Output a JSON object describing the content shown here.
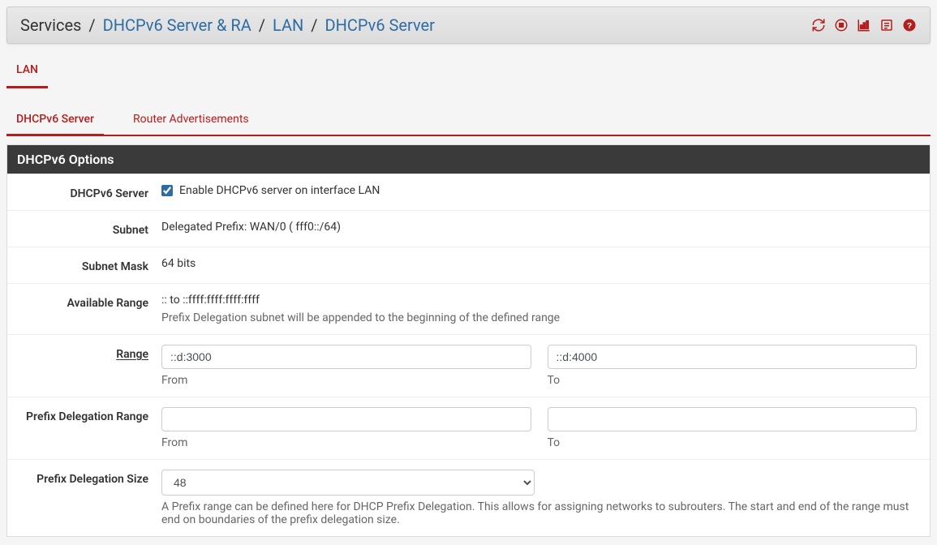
{
  "breadcrumb": {
    "root": "Services",
    "level1": "DHCPv6 Server & RA",
    "level2": "LAN",
    "level3": "DHCPv6 Server"
  },
  "header_icons": {
    "refresh": "refresh-icon",
    "stop": "stop-icon",
    "stats": "stats-icon",
    "log": "log-icon",
    "help": "help-icon"
  },
  "tabs_primary": [
    {
      "label": "LAN",
      "active": true
    }
  ],
  "tabs_secondary": [
    {
      "label": "DHCPv6 Server",
      "active": true
    },
    {
      "label": "Router Advertisements",
      "active": false
    }
  ],
  "panel": {
    "title": "DHCPv6 Options",
    "rows": {
      "dhcpv6_server": {
        "label": "DHCPv6 Server",
        "checkbox_checked": true,
        "checkbox_label": "Enable DHCPv6 server on interface LAN"
      },
      "subnet": {
        "label": "Subnet",
        "value": "Delegated Prefix: WAN/0 (                          fff0::/64)"
      },
      "subnet_mask": {
        "label": "Subnet Mask",
        "value": "64 bits"
      },
      "available_range": {
        "label": "Available Range",
        "value": ":: to ::ffff:ffff:ffff:ffff",
        "help": "Prefix Delegation subnet will be appended to the beginning of the defined range"
      },
      "range": {
        "label": "Range",
        "from_value": "::d:3000",
        "from_label": "From",
        "to_value": "::d:4000",
        "to_label": "To"
      },
      "pd_range": {
        "label": "Prefix Delegation Range",
        "from_value": "",
        "from_label": "From",
        "to_value": "",
        "to_label": "To"
      },
      "pd_size": {
        "label": "Prefix Delegation Size",
        "value": "48",
        "help": "A Prefix range can be defined here for DHCP Prefix Delegation. This allows for assigning networks to subrouters. The start and end of the range must end on boundaries of the prefix delegation size."
      }
    }
  }
}
